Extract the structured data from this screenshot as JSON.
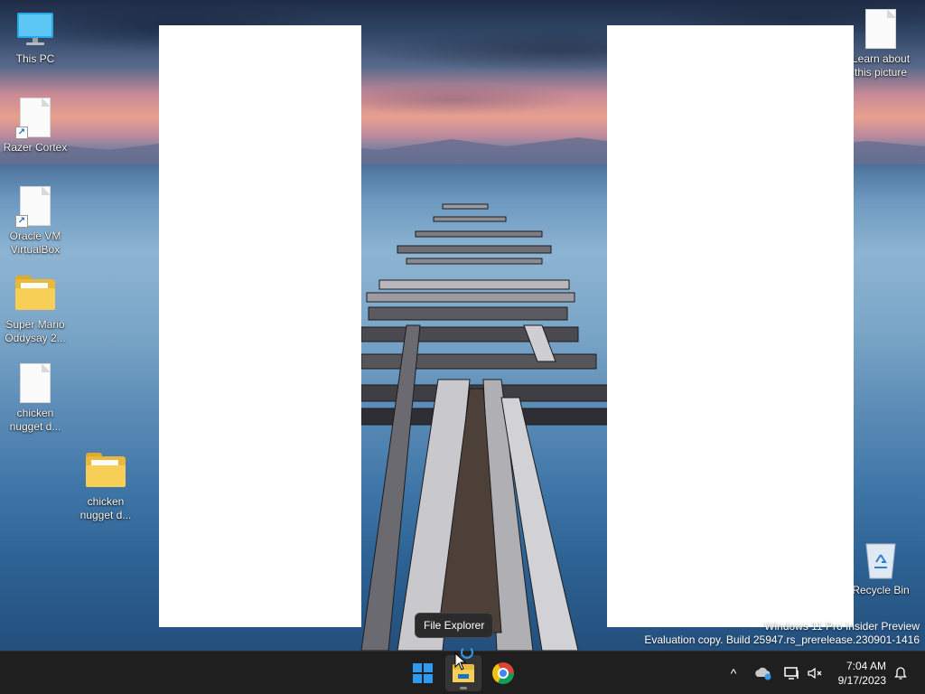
{
  "desktop": {
    "icons": [
      {
        "label": "This PC",
        "icon": "monitor-icon"
      },
      {
        "label": "Razer Cortex",
        "icon": "document-shortcut-icon"
      },
      {
        "label": "Oracle VM VirtualBox",
        "icon": "document-shortcut-icon"
      },
      {
        "label": "Super Mario Oddysay 2...",
        "icon": "folder-icon"
      },
      {
        "label": "chicken nugget d...",
        "icon": "document-icon"
      },
      {
        "label": "chicken nugget d...",
        "icon": "folder-icon"
      },
      {
        "label": "Learn about this picture",
        "icon": "document-icon"
      },
      {
        "label": "Recycle Bin",
        "icon": "recycle-bin-icon"
      }
    ]
  },
  "watermark": {
    "line1": "Windows 11 Pro Insider Preview",
    "line2": "Evaluation copy. Build 25947.rs_prerelease.230901-1416"
  },
  "tooltip": {
    "text": "File Explorer"
  },
  "taskbar": {
    "apps": [
      {
        "name": "Start",
        "icon": "windows-start-icon"
      },
      {
        "name": "File Explorer",
        "icon": "file-explorer-icon",
        "active": true
      },
      {
        "name": "Google Chrome",
        "icon": "chrome-icon"
      }
    ],
    "tray": {
      "chevron": "^",
      "clock_time": "7:04 AM",
      "clock_date": "9/17/2023"
    }
  },
  "colors": {
    "taskbar_bg": "#1f1f1f",
    "accent": "#2f9bf0",
    "pane": "#ffffff"
  }
}
